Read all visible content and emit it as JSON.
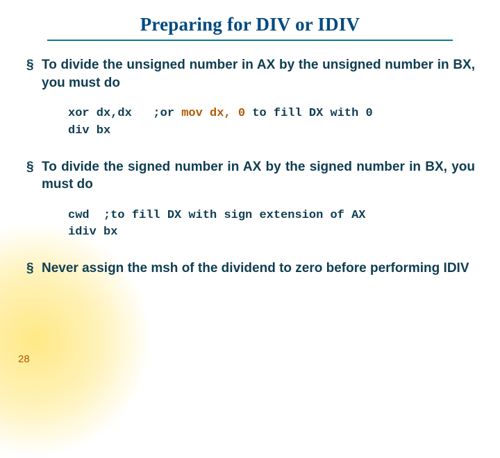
{
  "title": "Preparing for DIV or IDIV",
  "bullets": {
    "b1": "To divide the unsigned number in AX by the unsigned number in BX, you must do",
    "b2": "To divide the signed number in AX by the signed number in BX, you must do",
    "b3": "Never assign the msh of the dividend to zero before performing IDIV"
  },
  "code1": {
    "l1a": "xor dx,dx   ",
    "l1b": ";or ",
    "l1c": "mov dx, 0",
    "l1d": " to fill DX with 0",
    "l2": "div bx"
  },
  "code2": {
    "l1a": "cwd  ",
    "l1b": ";to fill DX with sign extension of AX",
    "l2": "idiv bx"
  },
  "page_number": "28"
}
